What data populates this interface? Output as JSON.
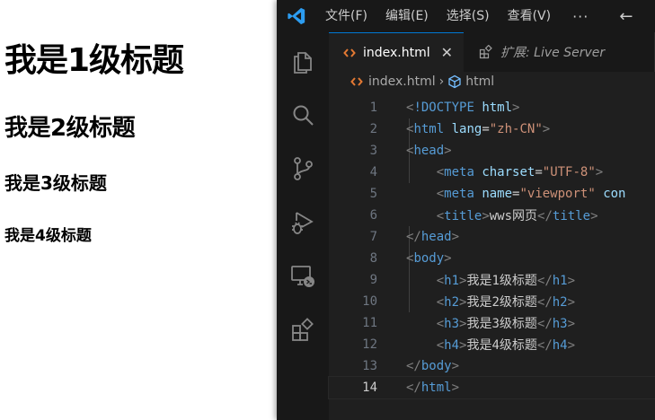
{
  "preview": {
    "h1": "我是1级标题",
    "h2": "我是2级标题",
    "h3": "我是3级标题",
    "h4": "我是4级标题"
  },
  "vscode": {
    "menu": [
      "文件(F)",
      "编辑(E)",
      "选择(S)",
      "查看(V)"
    ],
    "menu_more": "···",
    "tabs": {
      "active_label": "index.html",
      "inactive_label": "扩展: Live Server"
    },
    "breadcrumb": {
      "file": "index.html",
      "symbol": "html"
    },
    "colors": {
      "accent": "#0078d4",
      "html_icon": "#e37933",
      "tag": "#569cd6",
      "attr": "#9cdcfe",
      "string": "#ce9178"
    },
    "code": {
      "line_numbers": [
        "1",
        "2",
        "3",
        "4",
        "5",
        "6",
        "7",
        "8",
        "9",
        "10",
        "11",
        "12",
        "13",
        "14"
      ],
      "l1": {
        "b1": "<",
        "tag": "!DOCTYPE",
        "sp": " ",
        "attr": "html",
        "b2": ">"
      },
      "l2": {
        "b1": "<",
        "tag": "html",
        "sp": " ",
        "attr": "lang",
        "eq": "=",
        "str": "\"zh-CN\"",
        "b2": ">"
      },
      "l3": {
        "b1": "<",
        "tag": "head",
        "b2": ">"
      },
      "l4": {
        "indent": "    ",
        "b1": "<",
        "tag": "meta",
        "sp": " ",
        "attr": "charset",
        "eq": "=",
        "str": "\"UTF-8\"",
        "b2": ">"
      },
      "l5": {
        "indent": "    ",
        "b1": "<",
        "tag": "meta",
        "sp": " ",
        "attr": "name",
        "eq": "=",
        "str": "\"viewport\"",
        "sp2": " ",
        "attr2": "con"
      },
      "l6": {
        "indent": "    ",
        "b1": "<",
        "tag": "title",
        "b2": ">",
        "text": "wws网页",
        "b3": "</",
        "tag2": "title",
        "b4": ">"
      },
      "l7": {
        "b1": "</",
        "tag": "head",
        "b2": ">"
      },
      "l8": {
        "b1": "<",
        "tag": "body",
        "b2": ">"
      },
      "l9": {
        "indent": "    ",
        "b1": "<",
        "tag": "h1",
        "b2": ">",
        "text": "我是1级标题",
        "b3": "</",
        "tag2": "h1",
        "b4": ">"
      },
      "l10": {
        "indent": "    ",
        "b1": "<",
        "tag": "h2",
        "b2": ">",
        "text": "我是2级标题",
        "b3": "</",
        "tag2": "h2",
        "b4": ">"
      },
      "l11": {
        "indent": "    ",
        "b1": "<",
        "tag": "h3",
        "b2": ">",
        "text": "我是3级标题",
        "b3": "</",
        "tag2": "h3",
        "b4": ">"
      },
      "l12": {
        "indent": "    ",
        "b1": "<",
        "tag": "h4",
        "b2": ">",
        "text": "我是4级标题",
        "b3": "</",
        "tag2": "h4",
        "b4": ">"
      },
      "l13": {
        "b1": "</",
        "tag": "body",
        "b2": ">"
      },
      "l14": {
        "b1": "</",
        "tag": "html",
        "b2": ">"
      }
    },
    "activity_icons": [
      "explorer-icon",
      "search-icon",
      "source-control-icon",
      "run-debug-icon",
      "remote-explorer-icon",
      "extensions-icon"
    ]
  }
}
